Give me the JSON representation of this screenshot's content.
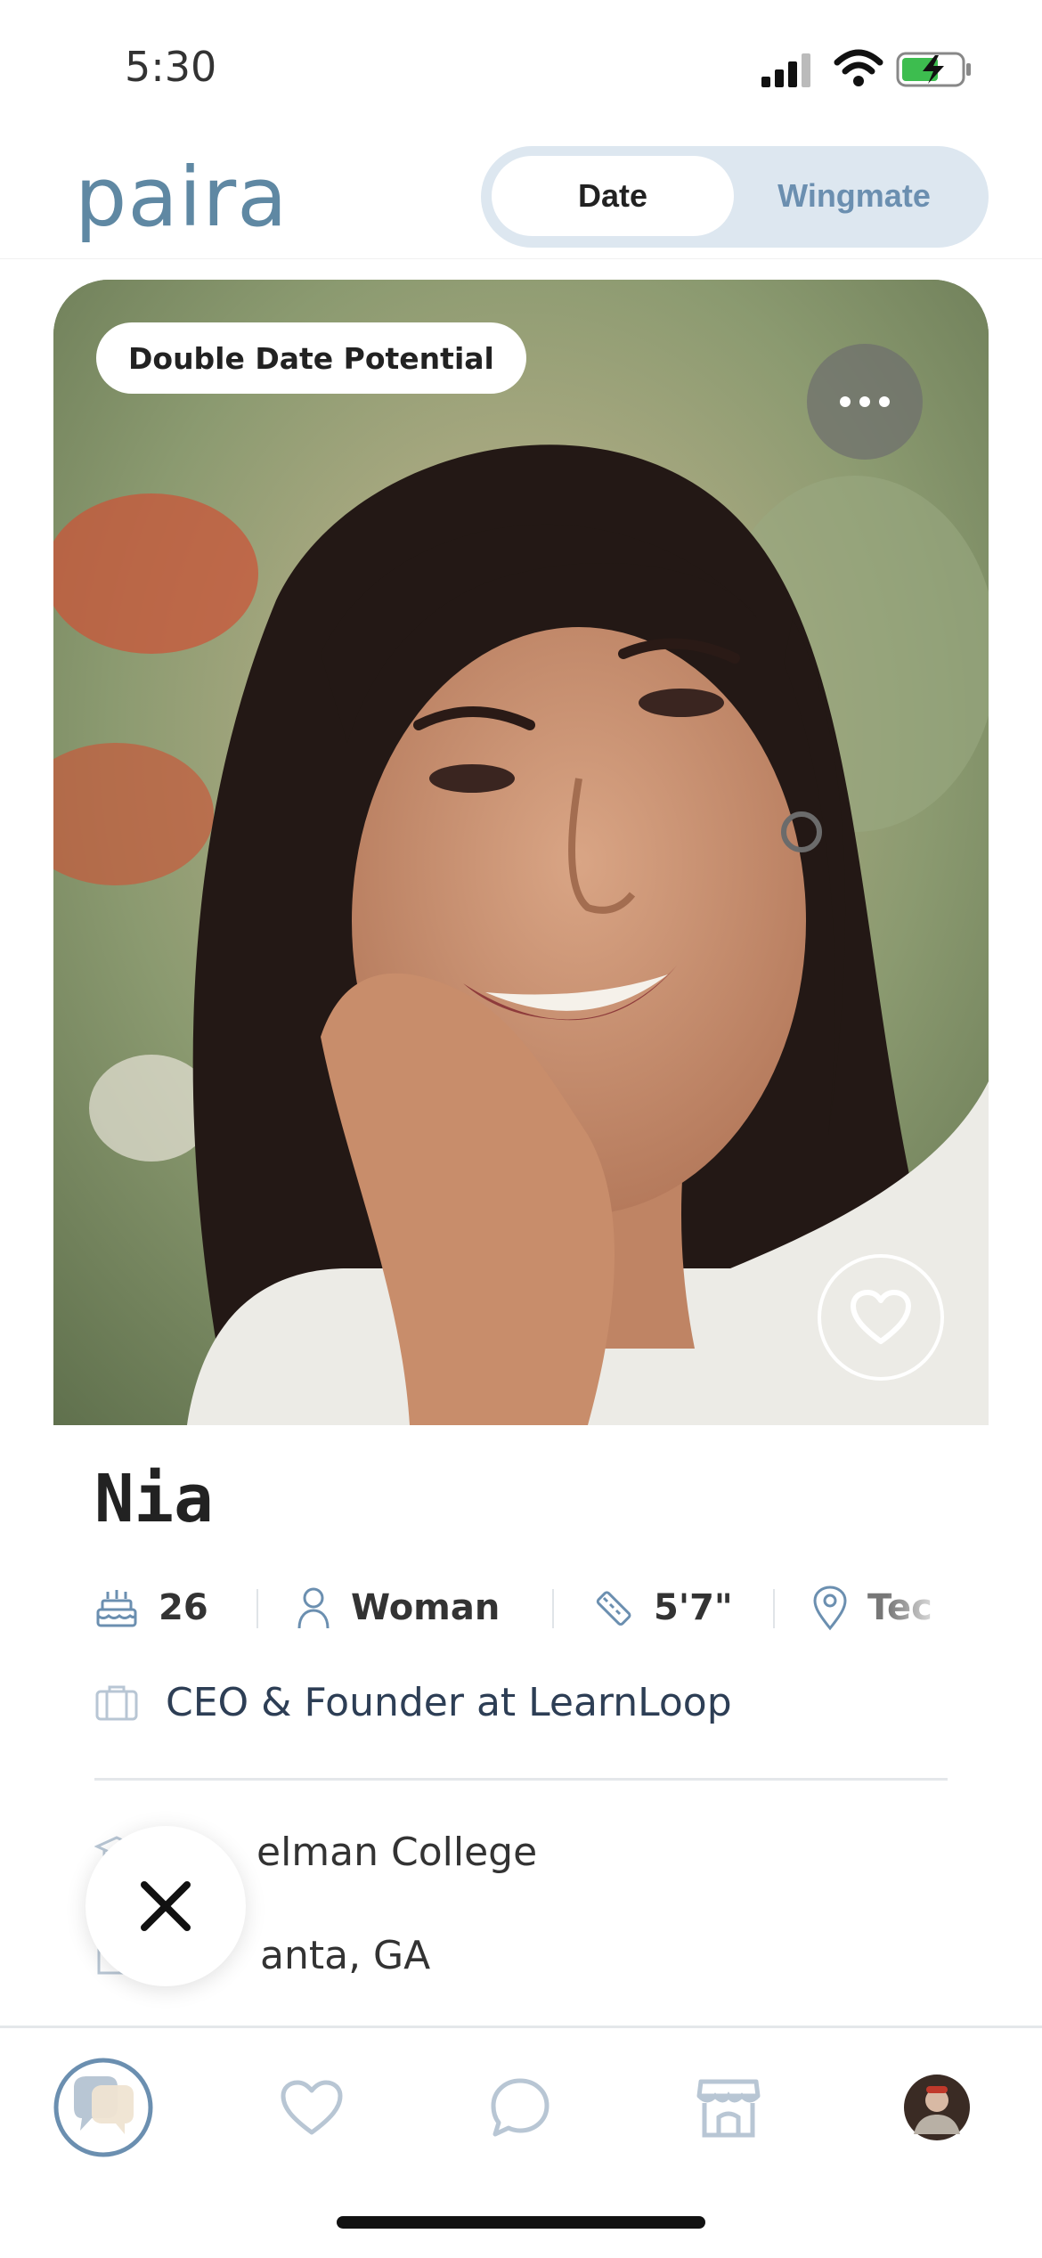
{
  "status_bar": {
    "time": "5:30"
  },
  "header": {
    "logo": "paira",
    "mode_toggle": {
      "selected": "Date",
      "options": [
        "Date",
        "Wingmate"
      ]
    }
  },
  "card": {
    "badge": "Double Date Potential",
    "name": "Nia",
    "attributes": [
      {
        "icon": "cake-icon",
        "value": "26"
      },
      {
        "icon": "person-icon",
        "value": "Woman"
      },
      {
        "icon": "ruler-icon",
        "value": "5'7\""
      },
      {
        "icon": "location-pin-icon",
        "value": "Tec"
      }
    ],
    "job": "CEO & Founder at LearnLoop",
    "school": "elman College",
    "city": "anta, GA"
  },
  "tab_bar": {
    "items": [
      "home-icon",
      "heart-icon",
      "chat-icon",
      "store-icon",
      "profile-avatar"
    ],
    "active": "home-icon"
  },
  "colors": {
    "accent": "#5f88a3",
    "toggle_bg": "#dde7f0",
    "icon_muted": "#b8c6d4",
    "text_dark": "#2d3e55"
  }
}
